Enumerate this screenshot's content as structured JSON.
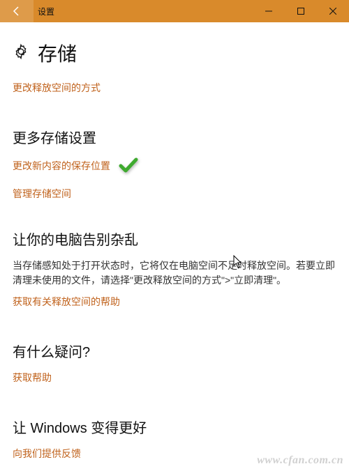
{
  "titlebar": {
    "title": "设置"
  },
  "page": {
    "title": "存储"
  },
  "link_free_method": "更改释放空间的方式",
  "section_more": {
    "title": "更多存储设置",
    "link_save_location": "更改新内容的保存位置",
    "link_manage": "管理存储空间"
  },
  "section_clutter": {
    "title": "让你的电脑告别杂乱",
    "body": "当存储感知处于打开状态时，它将仅在电脑空间不足时释放空间。若要立即清理未使用的文件，请选择\"更改释放空间的方式\">\"立即清理\"。",
    "link_help": "获取有关释放空间的帮助"
  },
  "section_question": {
    "title": "有什么疑问?",
    "link_help": "获取帮助"
  },
  "section_better": {
    "title": "让 Windows 变得更好",
    "link_feedback": "向我们提供反馈"
  },
  "watermark": "www.cfan.com.cn"
}
